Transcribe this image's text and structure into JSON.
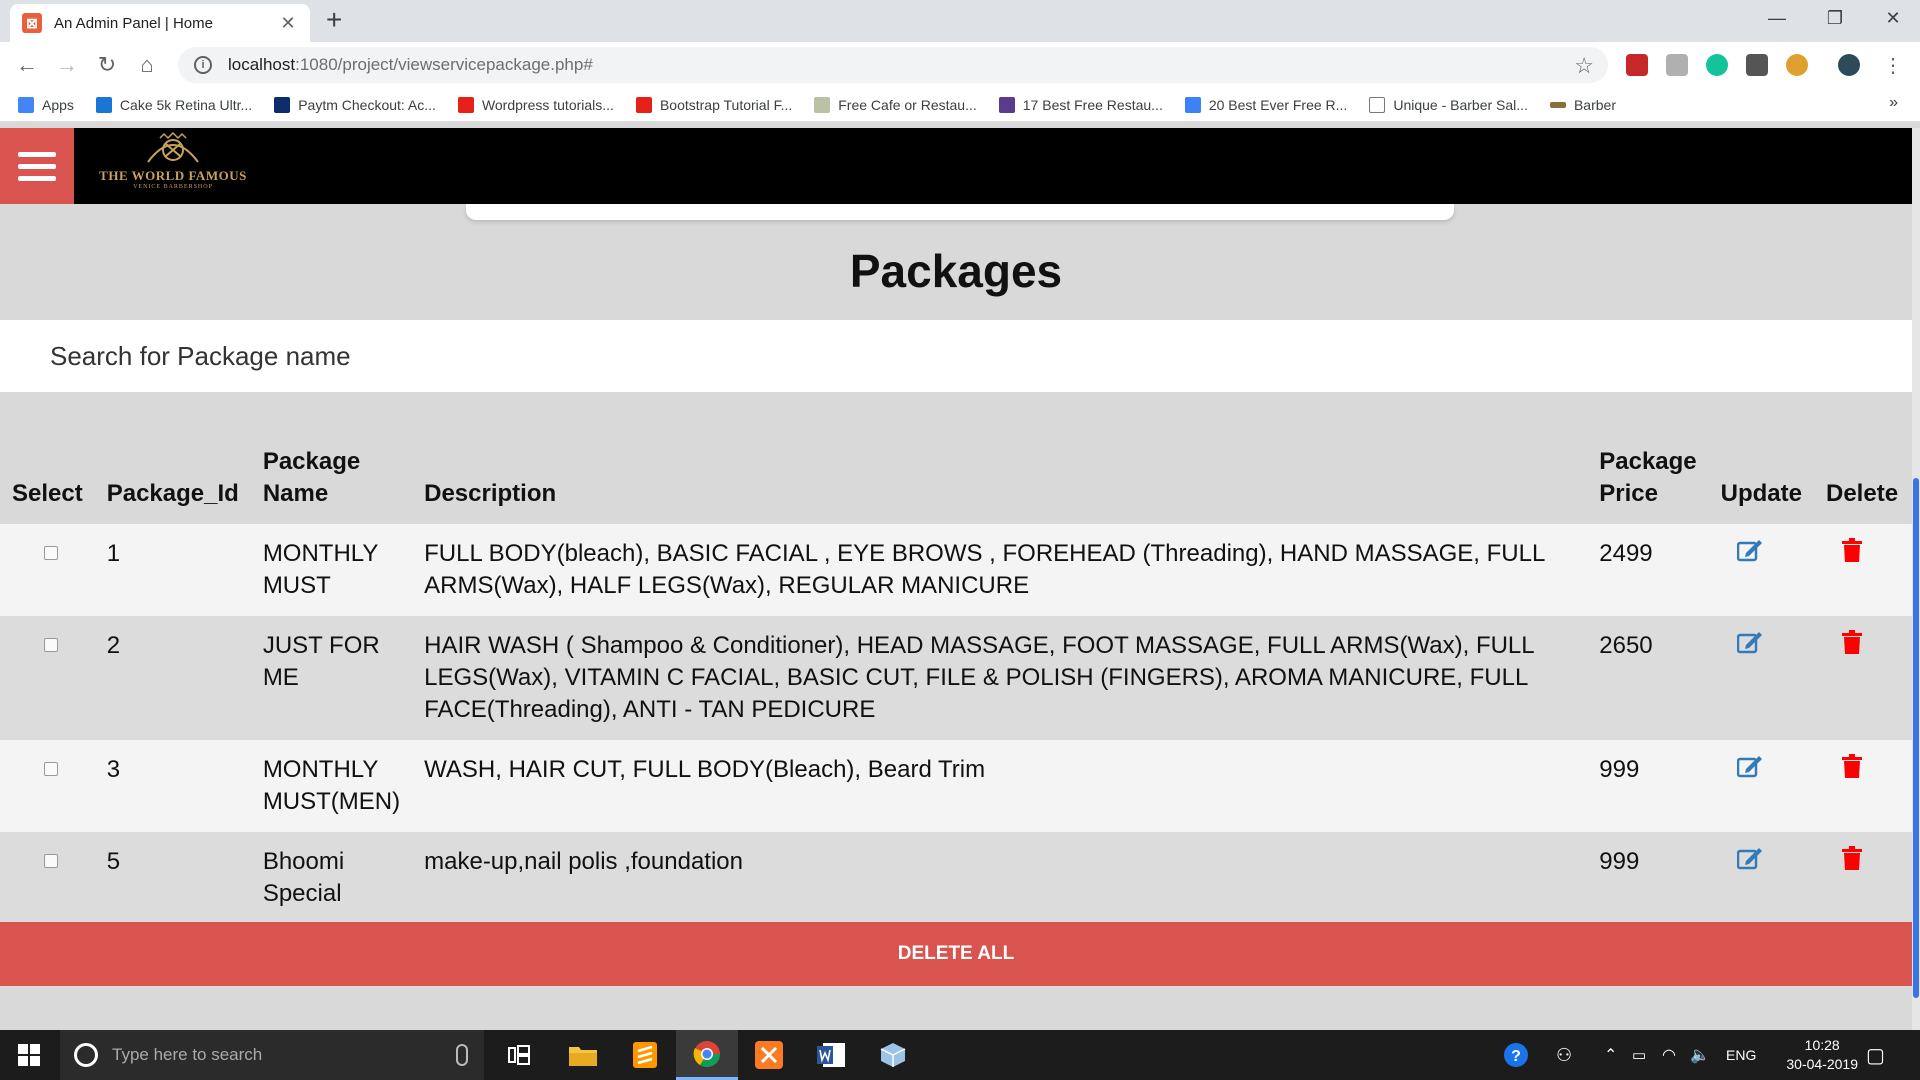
{
  "browser": {
    "tab_title": "An Admin Panel | Home",
    "tab_favicon": "xampp-icon",
    "url_host": "localhost",
    "url_path": ":1080/project/viewservicepackage.php#",
    "bookmarks": [
      {
        "label": "Apps",
        "icon": "apps-grid-icon",
        "color": "#4285f4"
      },
      {
        "label": "Cake 5k Retina Ultr...",
        "icon": "ui-kit-icon",
        "color": "#1976d2"
      },
      {
        "label": "Paytm Checkout: Ac...",
        "icon": "paytm-icon",
        "color": "#0d2c6c"
      },
      {
        "label": "Wordpress tutorials...",
        "icon": "youtube-icon",
        "color": "#e62117"
      },
      {
        "label": "Bootstrap Tutorial F...",
        "icon": "youtube-icon",
        "color": "#e62117"
      },
      {
        "label": "Free Cafe or Restau...",
        "icon": "template-icon",
        "color": "#b8c2a4"
      },
      {
        "label": "17 Best Free Restau...",
        "icon": "colorlib-icon",
        "color": "#5b3b8c"
      },
      {
        "label": "20 Best Ever Free R...",
        "icon": "bookmark-page-icon",
        "color": "#3b82f6"
      },
      {
        "label": "Unique - Barber Sal...",
        "icon": "document-icon",
        "color": "#777777"
      },
      {
        "label": "Barber",
        "icon": "mustache-icon",
        "color": "#8a6d3b"
      }
    ]
  },
  "header": {
    "brand_line1": "THE WORLD FAMOUS",
    "brand_line2": "VENICE BARBERSHOP"
  },
  "page": {
    "title": "Packages",
    "search_placeholder": "Search for Package name",
    "columns": {
      "select": "Select",
      "id": "Package_Id",
      "name": "Package Name",
      "description": "Description",
      "price": "Package Price",
      "update": "Update",
      "delete": "Delete"
    },
    "rows": [
      {
        "id": "1",
        "name": "MONTHLY MUST",
        "description": "FULL BODY(bleach), BASIC FACIAL , EYE BROWS , FOREHEAD (Threading), HAND MASSAGE, FULL ARMS(Wax), HALF LEGS(Wax), REGULAR MANICURE",
        "price": "2499"
      },
      {
        "id": "2",
        "name": "JUST FOR ME",
        "description": "HAIR WASH ( Shampoo & Conditioner), HEAD MASSAGE, FOOT MASSAGE, FULL ARMS(Wax), FULL LEGS(Wax), VITAMIN C FACIAL, BASIC CUT, FILE & POLISH (FINGERS), AROMA MANICURE, FULL FACE(Threading), ANTI - TAN PEDICURE",
        "price": "2650"
      },
      {
        "id": "3",
        "name": "MONTHLY MUST(MEN)",
        "description": "WASH, HAIR CUT, FULL BODY(Bleach), Beard Trim",
        "price": "999"
      },
      {
        "id": "5",
        "name": "Bhoomi Special",
        "description": "make-up,nail polis ,foundation",
        "price": "999"
      }
    ],
    "delete_all_label": "DELETE ALL"
  },
  "taskbar": {
    "search_placeholder": "Type here to search",
    "lang": "ENG",
    "time": "10:28",
    "date": "30-04-2019"
  },
  "colors": {
    "accent_red": "#d9534f",
    "edit_blue": "#337ab7",
    "trash_red": "#ff0000"
  }
}
